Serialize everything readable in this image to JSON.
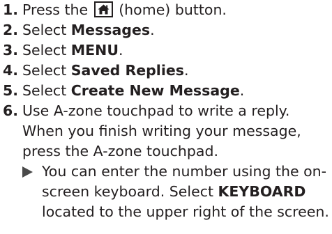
{
  "steps": [
    {
      "num": "1.",
      "pre": "Press the",
      "icon": "home-icon",
      "post": "(home) button."
    },
    {
      "num": "2.",
      "pre": "Select ",
      "bold": "Messages",
      "post": "."
    },
    {
      "num": "3.",
      "pre": "Select ",
      "bold": "MENU",
      "post": "."
    },
    {
      "num": "4.",
      "pre": "Select ",
      "bold": "Saved Replies",
      "post": "."
    },
    {
      "num": "5.",
      "pre": "Select ",
      "bold": "Create New Message",
      "post": "."
    },
    {
      "num": "6.",
      "lines": [
        "Use A-zone touchpad to write a reply.",
        "When you finish writing your message,",
        "press the A-zone touchpad."
      ]
    }
  ],
  "note": {
    "icon": "triangle-pointer-icon",
    "line1": "You can enter the number using the on-",
    "line2_pre": "screen keyboard. Select ",
    "line2_bold": "KEYBOARD",
    "line3": "located to the upper right of the screen."
  }
}
